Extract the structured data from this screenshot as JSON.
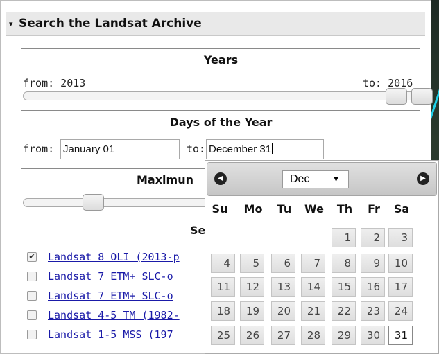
{
  "panel": {
    "title": "Search the Landsat Archive",
    "collapse_glyph": "▾"
  },
  "years": {
    "title": "Years",
    "from_label": "from: 2013",
    "to_label": "to: 2016"
  },
  "days": {
    "title": "Days of the Year",
    "from_label": "from:",
    "from_value": "January 01",
    "to_label": "to:",
    "to_value": "December 31"
  },
  "maximum": {
    "title_visible": "Maximun"
  },
  "sensors": {
    "title_visible": "Se",
    "items": [
      {
        "label": "Landsat 8 OLI (2013-p",
        "checked": true
      },
      {
        "label": "Landsat 7 ETM+ SLC-o",
        "checked": false
      },
      {
        "label": "Landsat 7 ETM+ SLC-o",
        "checked": false
      },
      {
        "label": "Landsat 4-5 TM (1982-",
        "checked": false
      },
      {
        "label": "Landsat 1-5 MSS (197",
        "checked": false
      }
    ]
  },
  "datepicker": {
    "prev_icon": "◀",
    "next_icon": "▶",
    "month": "Dec",
    "dropdown_arrow": "▼",
    "weekdays": [
      "Su",
      "Mo",
      "Tu",
      "We",
      "Th",
      "Fr",
      "Sa"
    ],
    "weeks": [
      [
        "",
        "",
        "",
        "",
        "1",
        "2",
        "3"
      ],
      [
        "4",
        "5",
        "6",
        "7",
        "8",
        "9",
        "10"
      ],
      [
        "11",
        "12",
        "13",
        "14",
        "15",
        "16",
        "17"
      ],
      [
        "18",
        "19",
        "20",
        "21",
        "22",
        "23",
        "24"
      ],
      [
        "25",
        "26",
        "27",
        "28",
        "29",
        "30",
        "31"
      ]
    ],
    "selected_day": "31"
  },
  "colors": {
    "link": "#1a1aa8",
    "map_accent": "#1fd0e8"
  }
}
